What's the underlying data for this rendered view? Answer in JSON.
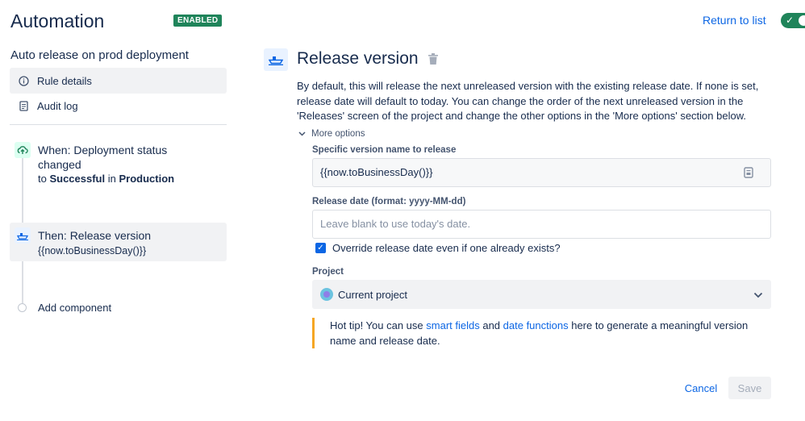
{
  "header": {
    "title": "Automation",
    "status_badge": "ENABLED",
    "return_link": "Return to list"
  },
  "sidebar": {
    "rule_name": "Auto release on prod deployment",
    "items": [
      {
        "label": "Rule details",
        "icon": "info-icon"
      },
      {
        "label": "Audit log",
        "icon": "document-icon"
      }
    ],
    "when": {
      "title": "When: Deployment status changed",
      "prefix": "to",
      "status": "Successful",
      "joiner": "in",
      "environment": "Production"
    },
    "then": {
      "title": "Then: Release version",
      "sub": "{{now.toBusinessDay()}}"
    },
    "add_component": "Add component"
  },
  "main": {
    "title": "Release version",
    "description": "By default, this will release the next unreleased version with the existing release date. If none is set, release date will default to today. You can change the order of the next unreleased version in the 'Releases' screen of the project and change the other options in the 'More options' section below.",
    "more_options": "More options",
    "version_label": "Specific version name to release",
    "version_value": "{{now.toBusinessDay()}}",
    "date_label": "Release date (format: yyyy-MM-dd)",
    "date_placeholder": "Leave blank to use today's date.",
    "override_label": "Override release date even if one already exists?",
    "override_checked": true,
    "project_label": "Project",
    "project_value": "Current project",
    "tip": {
      "prefix": "Hot tip! You can use ",
      "link1": "smart fields",
      "middle": " and ",
      "link2": "date functions",
      "suffix": " here to generate a meaningful version name and release date."
    },
    "cancel": "Cancel",
    "save": "Save"
  },
  "colors": {
    "accent": "#0c66e4",
    "enabled": "#1f845a",
    "tip_border": "#f5a623"
  }
}
